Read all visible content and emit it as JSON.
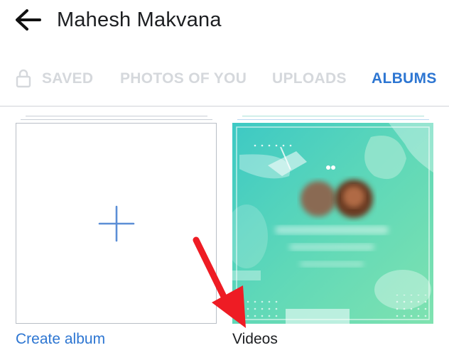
{
  "header": {
    "title": "Mahesh Makvana"
  },
  "tabs": [
    {
      "label": "SAVED",
      "active": false,
      "locked": true
    },
    {
      "label": "PHOTOS OF YOU",
      "active": false
    },
    {
      "label": "UPLOADS",
      "active": false
    },
    {
      "label": "ALBUMS",
      "active": true
    }
  ],
  "albums": [
    {
      "label": "Create album",
      "icon": "plus-icon"
    },
    {
      "label": "Videos"
    }
  ],
  "colors": {
    "accent": "#2d76d2",
    "inactive_tab": "#d5d8dc",
    "annotation_arrow": "#ee1c24"
  }
}
